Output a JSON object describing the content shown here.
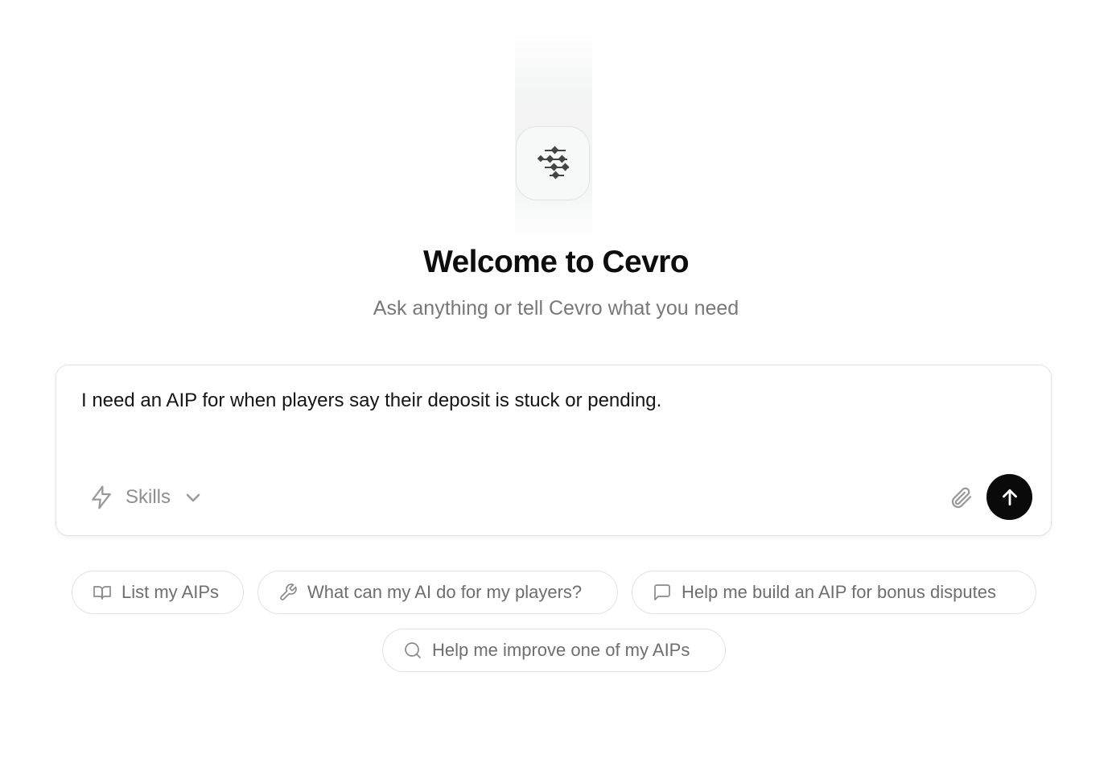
{
  "welcome": {
    "title": "Welcome to Cevro",
    "subtitle": "Ask anything or tell Cevro what you need"
  },
  "composer": {
    "value": "I need an AIP for when players say their deposit is stuck or pending.",
    "skills_label": "Skills"
  },
  "suggestions": [
    {
      "label": "List my AIPs",
      "icon": "book-open-icon"
    },
    {
      "label": "What can my AI do for my players?",
      "icon": "wrench-icon"
    },
    {
      "label": "Help me build an AIP for bonus disputes",
      "icon": "message-square-icon"
    },
    {
      "label": "Help me improve one of my AIPs",
      "icon": "search-icon"
    }
  ],
  "colors": {
    "send_button": "#0a0a0a",
    "muted_text": "#787878",
    "border": "#e3e3e3"
  }
}
